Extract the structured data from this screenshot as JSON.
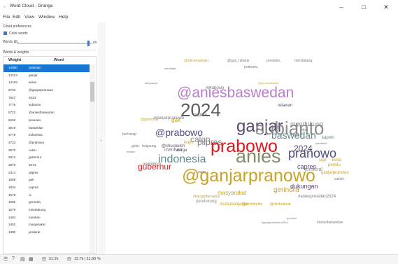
{
  "window": {
    "title": "Word Cloud - Orange",
    "app_icon": "orange-app-icon",
    "minimize": "–",
    "maximize": "□",
    "close": "✕"
  },
  "menu": [
    "File",
    "Edit",
    "View",
    "Window",
    "Help"
  ],
  "left_panel": {
    "cloud_preferences_label": "Cloud preferences",
    "color_words_label": "Color words",
    "color_words_checked": true,
    "words_tilt_label": "Words tilt:",
    "words_tilt_value": "no",
    "words_weights_label": "Words & weights"
  },
  "table": {
    "headers": {
      "weight": "Weight",
      "word": "Word"
    },
    "rows": [
      {
        "weight": "14890",
        "word": "prabowo",
        "selected": true
      },
      {
        "weight": "14213",
        "word": "ganjar",
        "selected": false
      },
      {
        "weight": "14163",
        "word": "anies",
        "selected": false
      },
      {
        "weight": "8732",
        "word": "@ganjarpranowo",
        "selected": false
      },
      {
        "weight": "7927",
        "word": "2024",
        "selected": false
      },
      {
        "weight": "7776",
        "word": "subianto",
        "selected": false
      },
      {
        "weight": "5723",
        "word": "@aniesbaswedan",
        "selected": false
      },
      {
        "weight": "5262",
        "word": "pranowo",
        "selected": false
      },
      {
        "weight": "3919",
        "word": "baswedan",
        "selected": false
      },
      {
        "weight": "3778",
        "word": "indonesia",
        "selected": false
      },
      {
        "weight": "3722",
        "word": "@prabowo",
        "selected": false
      },
      {
        "weight": "3070",
        "word": "calon",
        "selected": false
      },
      {
        "weight": "2912",
        "word": "gubernur",
        "selected": false
      },
      {
        "weight": "2879",
        "word": "2074",
        "selected": false
      },
      {
        "weight": "2314",
        "word": "pilpres",
        "selected": false
      },
      {
        "weight": "1858",
        "word": "gak",
        "selected": false
      },
      {
        "weight": "1834",
        "word": "capres",
        "selected": false
      },
      {
        "weight": "1678",
        "word": "ni",
        "selected": false
      },
      {
        "weight": "1666",
        "word": "gerindra",
        "selected": false
      },
      {
        "weight": "1579",
        "word": "mendukung",
        "selected": false
      },
      {
        "weight": "1464",
        "word": "menhan",
        "selected": false
      },
      {
        "weight": "1452",
        "word": "masyarakat",
        "selected": false
      },
      {
        "weight": "1400",
        "word": "jenderal",
        "selected": false
      }
    ]
  },
  "cloud_words": [
    {
      "text": "prabowo",
      "color": "#e3141b",
      "size": 25
    },
    {
      "text": "@ganjarpranowo",
      "color": "#c9a227",
      "size": 25
    },
    {
      "text": "anies",
      "color": "#7e8c6a",
      "size": 27
    },
    {
      "text": "2024",
      "color": "#5a5a5a",
      "size": 26
    },
    {
      "text": "ganjar",
      "color": "#5c4670",
      "size": 24
    },
    {
      "text": "subianto",
      "color": "#8d8d8d",
      "size": 26
    },
    {
      "text": "@aniesbaswedan",
      "color": "#b97ec8",
      "size": 21
    },
    {
      "text": "pranowo",
      "color": "#4d4d86",
      "size": 18
    },
    {
      "text": "indonesia",
      "color": "#5f8b8f",
      "size": 16
    },
    {
      "text": "baswedan",
      "color": "#5f8b8f",
      "size": 14
    },
    {
      "text": "@prabowo",
      "color": "#4d4d86",
      "size": 14
    },
    {
      "text": "gubernur",
      "color": "#e3141b",
      "size": 12
    },
    {
      "text": "calon",
      "color": "#8d8d8d",
      "size": 12
    },
    {
      "text": "pilpres",
      "color": "#7a7a7a",
      "size": 12
    },
    {
      "text": "2024",
      "color": "#5c4670",
      "size": 12
    },
    {
      "text": "capres",
      "color": "#5c4670",
      "size": 9
    },
    {
      "text": "gerindra",
      "color": "#c9a227",
      "size": 10
    },
    {
      "text": "mendukung",
      "color": "#8d8d8d",
      "size": 9
    },
    {
      "text": "dukungan",
      "color": "#5c4670",
      "size": 9
    },
    {
      "text": "masyarakat",
      "color": "#c9a227",
      "size": 8
    },
    {
      "text": "jenderal",
      "color": "#8d8d8d",
      "size": 7
    },
    {
      "text": "menhan",
      "color": "#7a7a7a",
      "size": 7
    },
    {
      "text": "pendukung",
      "color": "#8d8d8d",
      "size": 6
    },
    {
      "text": "#sahabatganjar",
      "color": "#c9a227",
      "size": 6
    },
    {
      "text": "@chusnulch",
      "color": "#5c4670",
      "size": 6
    },
    {
      "text": "relawan",
      "color": "#5c4670",
      "size": 6
    },
    {
      "text": "kapolri",
      "color": "#5f8b8f",
      "size": 6
    },
    {
      "text": "gak",
      "color": "#c9a227",
      "size": 8
    },
    {
      "text": "#ganjarpranowo",
      "color": "#7a7a7a",
      "size": 6
    },
    {
      "text": "pemimpin",
      "color": "#7a7a7a",
      "size": 6
    },
    {
      "text": "sigit",
      "color": "#c9a227",
      "size": 6
    },
    {
      "text": "kerja",
      "color": "#c9a227",
      "size": 6
    },
    {
      "text": "pemilu",
      "color": "#c9a227",
      "size": 6
    },
    {
      "text": "ganjarpranowo",
      "color": "#c9a227",
      "size": 6
    },
    {
      "text": "#aniespresiden2024",
      "color": "#7a7a7a",
      "size": 6
    },
    {
      "text": "@gerindra",
      "color": "#c9a227",
      "size": 5
    },
    {
      "text": "listyo",
      "color": "#c9a227",
      "size": 6
    },
    {
      "text": "warga",
      "color": "#5c4670",
      "size": 6
    },
    {
      "text": "negara",
      "color": "#7a7a7a",
      "size": 6
    },
    {
      "text": "@ericktholhir",
      "color": "#c9a227",
      "size": 5
    },
    {
      "text": "@dinihrdianti",
      "color": "#c9a227",
      "size": 5
    },
    {
      "text": "#bangkitbersama",
      "color": "#c9a227",
      "size": 5
    },
    {
      "text": "puan",
      "color": "#7a7a7a",
      "size": 5
    },
    {
      "text": "drs.",
      "color": "#7a7a7a",
      "size": 5
    },
    {
      "text": "@siticeriaselalu",
      "color": "#c9a227",
      "size": 5
    },
    {
      "text": "@gus_raharjo",
      "color": "#7a7a7a",
      "size": 5
    },
    {
      "text": "presiden,",
      "color": "#7a7a7a",
      "size": 5
    },
    {
      "text": "mendatang,",
      "color": "#7a7a7a",
      "size": 5
    },
    {
      "text": "prabowo,",
      "color": "#7a7a7a",
      "size": 5
    },
    {
      "text": "#aniesbaswedan",
      "color": "#7a7a7a",
      "size": 5
    },
    {
      "text": "#ganjarpresiden2024",
      "color": "#7a7a7a",
      "size": 4
    },
    {
      "text": "@gerindrakalbar",
      "color": "#c9a227",
      "size": 4
    },
    {
      "text": "provinsi",
      "color": "#7a7a7a",
      "size": 4
    },
    {
      "text": "erick",
      "color": "#7a7a7a",
      "size": 5
    },
    {
      "text": "vaksin",
      "color": "#7a7a7a",
      "size": 5
    },
    {
      "text": "president",
      "color": "#7a7a7a",
      "size": 4
    },
    {
      "text": "berharap",
      "color": "#7a7a7a",
      "size": 5
    },
    {
      "text": "langsung",
      "color": "#7a7a7a",
      "size": 5
    },
    {
      "text": "gelar",
      "color": "#7a7a7a",
      "size": 5
    },
    {
      "text": "ridwan",
      "color": "#7a7a7a",
      "size": 4
    },
    {
      "text": "#prabowo",
      "color": "#7a7a7a",
      "size": 6
    },
    {
      "text": "sandiaga",
      "color": "#7a7a7a",
      "size": 4
    },
    {
      "text": "kampanye",
      "color": "#7a7a7a",
      "size": 4
    },
    {
      "text": "&",
      "color": "#7a7a7a",
      "size": 7
    }
  ],
  "status_bar": {
    "data_in": "51.2k",
    "data_out": "12.7k | 11.89 %"
  }
}
